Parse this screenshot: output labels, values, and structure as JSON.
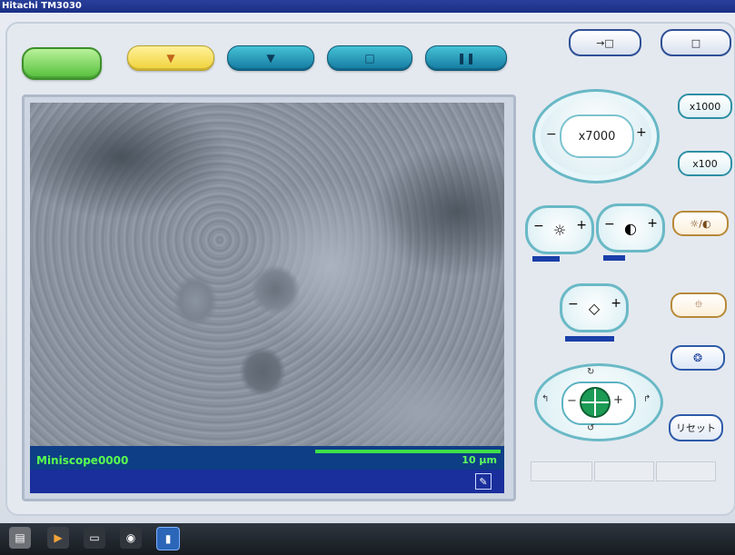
{
  "window": {
    "title": "Hitachi TM3030"
  },
  "toolbar": {
    "start_label": "",
    "yellow_label": "▼",
    "blue1_label": "▼",
    "blue2_label": "□",
    "blue3_label": "❚❚",
    "save1_label": "→□",
    "save2_label": "□"
  },
  "magnification": {
    "value": "x7000",
    "minus": "−",
    "plus": "+"
  },
  "preset_buttons": {
    "x1000": "x1000",
    "x100": "x100"
  },
  "image": {
    "name": "Miniscope0000",
    "scale": "10 μm"
  },
  "adjust": {
    "brightness_icon": "☼",
    "contrast_icon": "◐",
    "astig_icon": "◇",
    "auto_bc": "☼/◐"
  },
  "buttons": {
    "focus_auto": "⯐",
    "abcc": "❂",
    "reset": "リセット"
  },
  "stage": {
    "up": "↻",
    "down": "↺",
    "left": "↰",
    "right": "↱",
    "minus": "−",
    "plus": "+"
  },
  "taskbar": {
    "items": [
      "explorer-icon",
      "media-icon",
      "terminal-icon",
      "chrome-icon",
      "app-icon"
    ]
  }
}
